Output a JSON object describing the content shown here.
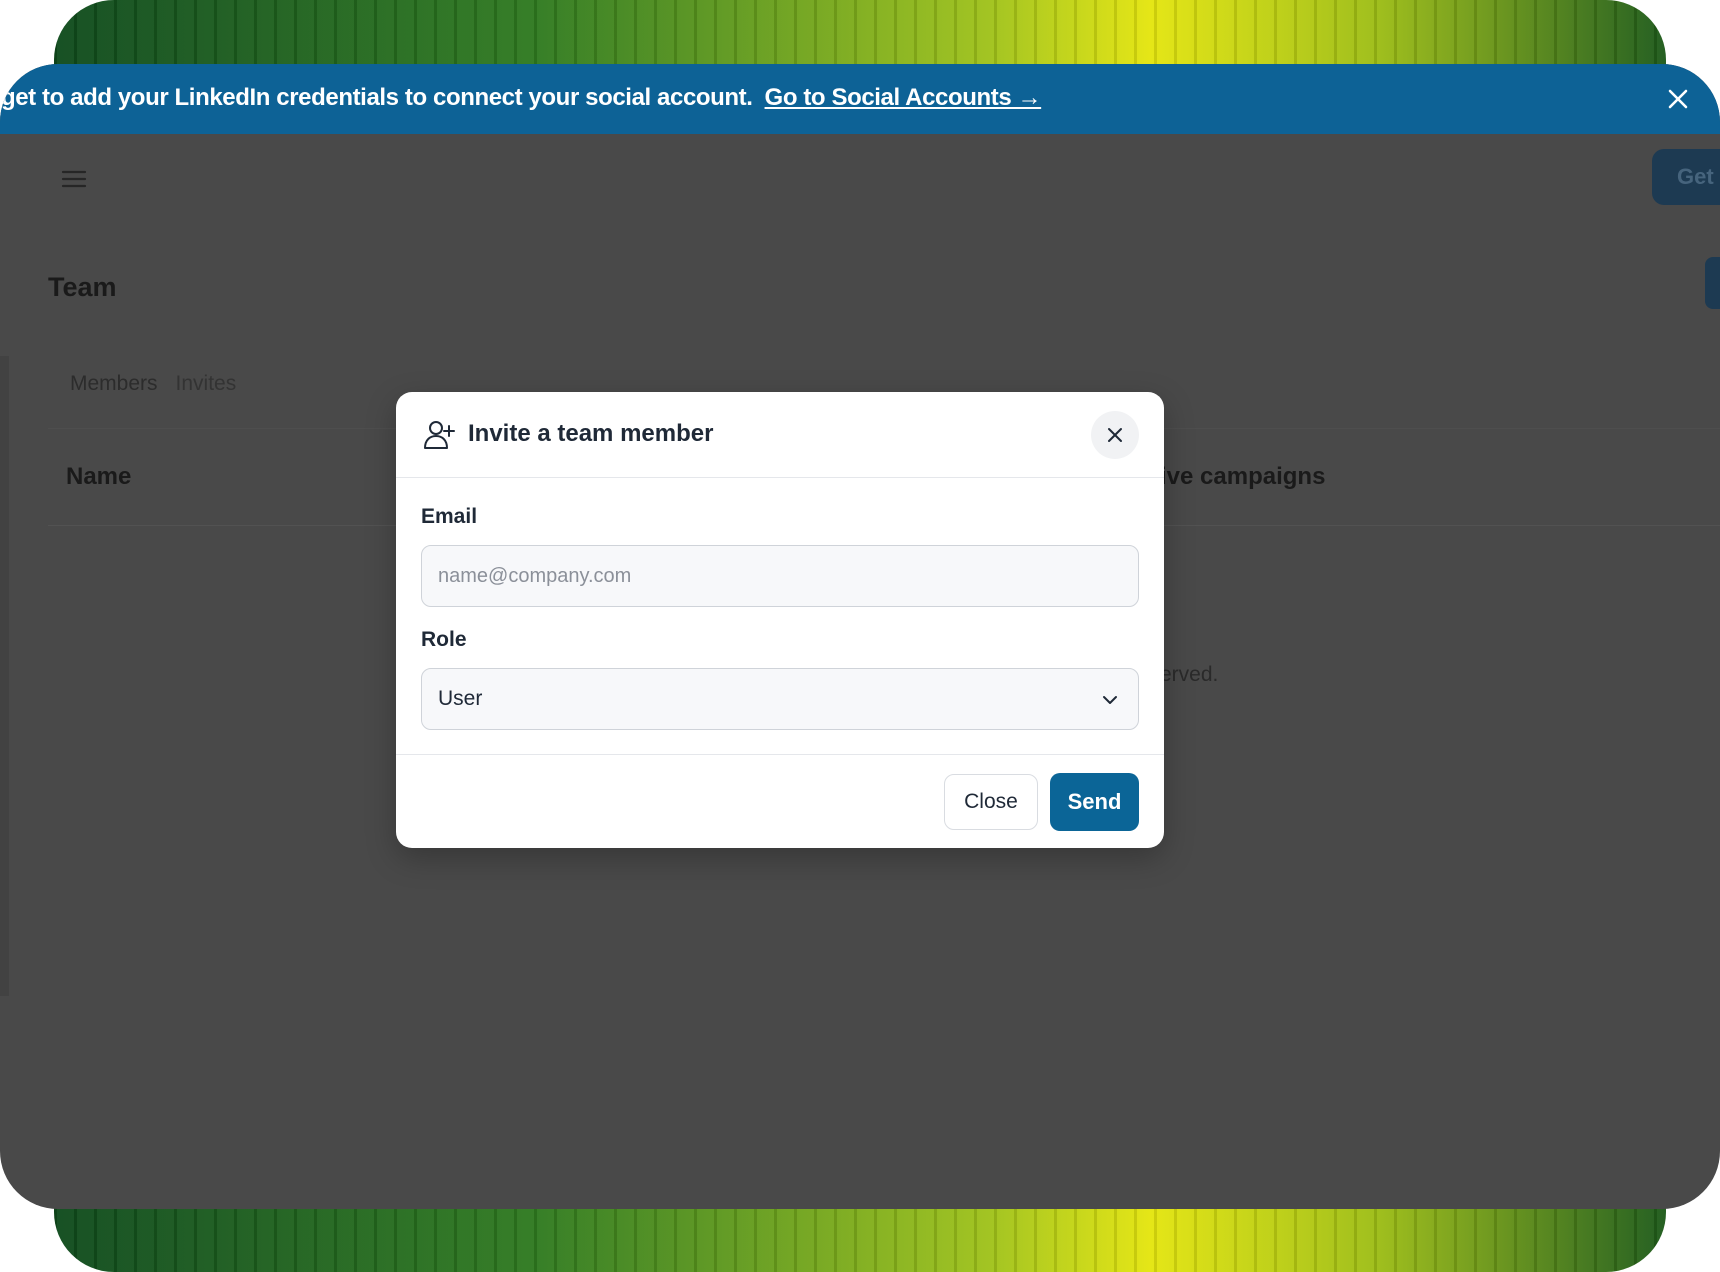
{
  "banner": {
    "message": "rget to add your LinkedIn credentials to connect your social account.",
    "link_label": "Go to Social Accounts →"
  },
  "header": {
    "get_button_label": "Get"
  },
  "page": {
    "title": "Team",
    "tabs": [
      {
        "label": "Members"
      },
      {
        "label": "Invites"
      }
    ],
    "table": {
      "columns": [
        "Name",
        "ive campaigns"
      ]
    },
    "empty_text": "erved."
  },
  "modal": {
    "title": "Invite a team member",
    "email": {
      "label": "Email",
      "placeholder": "name@company.com",
      "value": ""
    },
    "role": {
      "label": "Role",
      "selected": "User"
    },
    "close_label": "Close",
    "send_label": "Send"
  },
  "colors": {
    "banner": "#0d6296",
    "primary": "#0b6597",
    "overlay": "#494949"
  },
  "icons": {
    "banner_close": "close-icon",
    "menu": "hamburger-icon",
    "modal_header": "user-plus-icon",
    "modal_close": "close-icon",
    "select": "chevron-down-icon"
  }
}
